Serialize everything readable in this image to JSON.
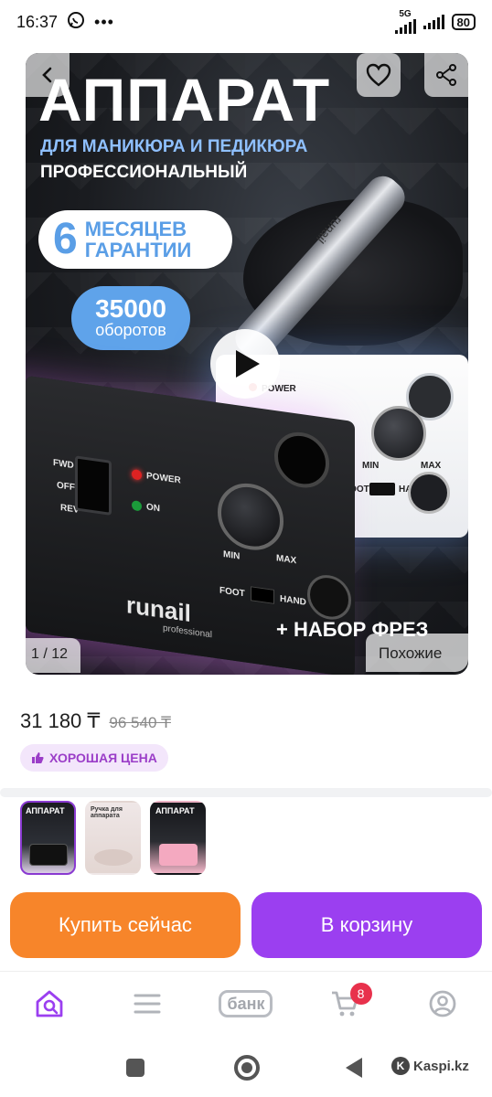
{
  "status_bar": {
    "time": "16:37",
    "network": "5G",
    "battery": "80",
    "icons": [
      "whatsapp-icon",
      "more-icon",
      "signal-icon",
      "battery-icon"
    ]
  },
  "hero": {
    "title": "АППАРАТ",
    "subtitle1": "ДЛЯ МАНИКЮРА И ПЕДИКЮРА",
    "subtitle2": "ПРОФЕССИОНАЛЬНЫЙ",
    "warranty_num": "6",
    "warranty_line1": "МЕСЯЦЕВ",
    "warranty_line2": "ГАРАНТИИ",
    "rpm_num": "35000",
    "rpm_label": "оборотов",
    "kit_label": "+ НАБОР ФРЕЗ",
    "counter": "1 / 12",
    "similar": "Похожие",
    "device_labels": {
      "fwd": "FWD",
      "off": "OFF",
      "rev": "REV",
      "power": "POWER",
      "on": "ON",
      "min": "MIN",
      "max": "MAX",
      "foot": "FOOT",
      "hand": "HAND",
      "brand": "runail",
      "brand_sub": "professional",
      "pen_brand": "runail"
    }
  },
  "price": {
    "current": "31 180 ₸",
    "old": "96 540 ₸",
    "badge": "ХОРОШАЯ ЦЕНА"
  },
  "thumbnails": [
    {
      "label": "АППАРАТ",
      "active": true
    },
    {
      "label": "Ручка для аппарата",
      "active": false
    },
    {
      "label": "АППАРАТ",
      "active": false
    }
  ],
  "actions": {
    "buy_now": "Купить сейчас",
    "add_to_cart": "В корзину"
  },
  "bottom_nav": {
    "bank_label": "банк",
    "cart_count": "8"
  },
  "watermark": "Kaspi.kz",
  "colors": {
    "orange": "#f7852a",
    "purple": "#9b3ff0",
    "badge_red": "#e8314c",
    "good_price": "#9b3ec8"
  }
}
